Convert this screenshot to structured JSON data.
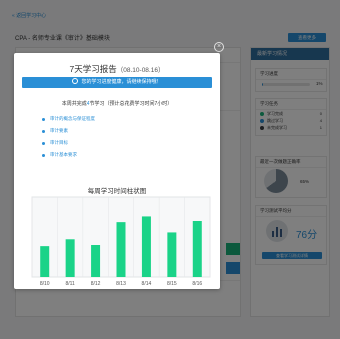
{
  "background": {
    "back_link": "« 返回学习中心",
    "course_title": "CPA - 名师专业课《审计》基础模块",
    "top_button": "查看更多",
    "sidebar": {
      "header": "最新学习情况",
      "progress": {
        "title": "学习进度",
        "value_text": "1%",
        "fraction": 0.01
      },
      "tasks": {
        "title": "学习任务",
        "rows": [
          {
            "label": "学习完成",
            "count": "0",
            "color": "#19b37a"
          },
          {
            "label": "跳过学习",
            "count": "4",
            "color": "#2a8fd6"
          },
          {
            "label": "未完成学习",
            "count": "1",
            "color": "#3a3f45"
          }
        ]
      },
      "accuracy": {
        "title": "最近一次做题正确率",
        "value_text": "65%",
        "fraction": 0.65
      },
      "score": {
        "title": "学习测试平均分",
        "value_text": "76分",
        "button": "查看学习测试详情"
      }
    }
  },
  "modal": {
    "title": "7天学习报告",
    "date_range": "（08.10-08.16）",
    "banner_text": "您的学习进度健康，请继续保持哦！",
    "plan_prefix": "本周共完成",
    "plan_count": "4",
    "plan_suffix": "节学习（预计总花费学习时间7小时）",
    "tasks": [
      "审计的概念与保证程度",
      "审计要素",
      "审计目标",
      "审计基本要求"
    ],
    "close_icon": "close-icon",
    "chart_title": "每周学习时间柱状图"
  },
  "chart_data": {
    "type": "bar",
    "title": "每周学习时间柱状图",
    "categories": [
      "8/10",
      "8/11",
      "8/12",
      "8/13",
      "8/14",
      "8/15",
      "8/16"
    ],
    "values": [
      27,
      33,
      28,
      48,
      53,
      39,
      49
    ],
    "ylim": [
      0,
      70
    ],
    "grid": true,
    "bar_color": "#1ad388"
  },
  "colors": {
    "accent": "#2a8fd6",
    "success": "#19b37a",
    "bar": "#1ad388"
  }
}
